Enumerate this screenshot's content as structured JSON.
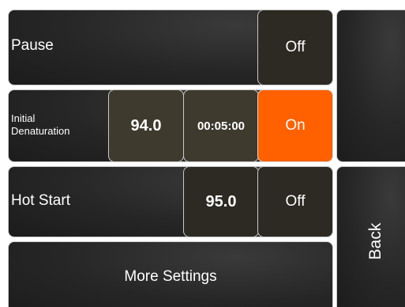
{
  "rows": {
    "pause": {
      "label": "Pause",
      "toggle": "Off"
    },
    "initial_denaturation": {
      "label_line1": "Initial",
      "label_line2": "Denaturation",
      "temperature": "94.0",
      "time": "00:05:00",
      "toggle": "On"
    },
    "hot_start": {
      "label": "Hot Start",
      "temperature": "95.0",
      "toggle": "Off"
    }
  },
  "more_settings": {
    "label": "More Settings"
  },
  "side": {
    "back_label": "Back"
  },
  "colors": {
    "on_accent": "#ff6000",
    "panel_dark": "#262626",
    "cell_dark": "#2d2a23",
    "border": "#c9c9c9"
  }
}
